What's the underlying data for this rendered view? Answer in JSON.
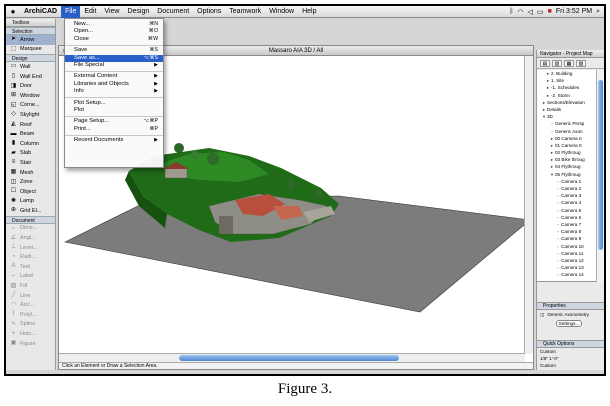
{
  "menubar": {
    "app": "ArchiCAD",
    "menus": [
      "File",
      "Edit",
      "View",
      "Design",
      "Document",
      "Options",
      "Teamwork",
      "Window",
      "Help"
    ],
    "clock": "Fri 3:52 PM",
    "flag": "■"
  },
  "toolbox": {
    "title": "Toolbox",
    "selection_label": "Selection",
    "arrow_label": "Arrow",
    "marquee_label": "Marquee",
    "design_section": "Design",
    "design_tools": [
      {
        "label": "Wall",
        "icon": "▭"
      },
      {
        "label": "Wall End",
        "icon": "▯"
      },
      {
        "label": "Door",
        "icon": "◨"
      },
      {
        "label": "Window",
        "icon": "⊞"
      },
      {
        "label": "Corne...",
        "icon": "◱"
      },
      {
        "label": "Skylight",
        "icon": "◇"
      },
      {
        "label": "Roof",
        "icon": "◭"
      },
      {
        "label": "Beam",
        "icon": "▬"
      },
      {
        "label": "Column",
        "icon": "▮"
      },
      {
        "label": "Slab",
        "icon": "▰"
      },
      {
        "label": "Stair",
        "icon": "≡"
      },
      {
        "label": "Mesh",
        "icon": "▦"
      },
      {
        "label": "Zone",
        "icon": "◫"
      },
      {
        "label": "Object",
        "icon": "☐"
      },
      {
        "label": "Lamp",
        "icon": "✺"
      },
      {
        "label": "Grid El...",
        "icon": "⊕"
      }
    ],
    "document_section": "Document",
    "document_tools": [
      {
        "label": "Dime...",
        "icon": "↔"
      },
      {
        "label": "Angl...",
        "icon": "∠"
      },
      {
        "label": "Level...",
        "icon": "⊥"
      },
      {
        "label": "Radi...",
        "icon": "◔"
      },
      {
        "label": "Text",
        "icon": "A"
      },
      {
        "label": "Label",
        "icon": "⌐"
      },
      {
        "label": "Fill",
        "icon": "▧"
      },
      {
        "label": "Line",
        "icon": "╱"
      },
      {
        "label": "Arc/...",
        "icon": "◠"
      },
      {
        "label": "Polyl...",
        "icon": "⌇"
      },
      {
        "label": "Spline",
        "icon": "∿"
      },
      {
        "label": "Hots...",
        "icon": "+"
      },
      {
        "label": "Figure",
        "icon": "▣"
      }
    ]
  },
  "file_menu": {
    "items": [
      {
        "type": "item",
        "label": "New...",
        "shortcut": "⌘N"
      },
      {
        "type": "item",
        "label": "Open...",
        "shortcut": "⌘O"
      },
      {
        "type": "item",
        "label": "Close",
        "shortcut": "⌘W"
      },
      {
        "type": "sep"
      },
      {
        "type": "item",
        "label": "Save",
        "shortcut": "⌘S"
      },
      {
        "type": "item",
        "label": "Save as...",
        "shortcut": "⌥⌘S",
        "highlight": true
      },
      {
        "type": "sub",
        "label": "File Special"
      },
      {
        "type": "sep"
      },
      {
        "type": "sub",
        "label": "External Content"
      },
      {
        "type": "sub",
        "label": "Libraries and Objects"
      },
      {
        "type": "sub",
        "label": "Info"
      },
      {
        "type": "sep"
      },
      {
        "type": "item",
        "label": "Plot Setup...",
        "shortcut": ""
      },
      {
        "type": "item",
        "label": "Plot",
        "shortcut": ""
      },
      {
        "type": "sep"
      },
      {
        "type": "item",
        "label": "Page Setup...",
        "shortcut": "⌥⌘P"
      },
      {
        "type": "item",
        "label": "Print...",
        "shortcut": "⌘P"
      },
      {
        "type": "sep"
      },
      {
        "type": "sub",
        "label": "Recent Documents"
      }
    ]
  },
  "window3d": {
    "title": "Massaro AIA 3D / All",
    "status": "Click an Element or Draw a Selection Area."
  },
  "navigator": {
    "title": "Navigator - Project Map",
    "tree": [
      {
        "label": "2. Building",
        "icon": "▸"
      },
      {
        "label": "1. Site",
        "icon": "▸"
      },
      {
        "label": "-1. Schedules",
        "icon": "▸"
      },
      {
        "label": "-2. Storm",
        "icon": "▸"
      },
      {
        "label": "Sections/Elevation",
        "icon": "▸"
      },
      {
        "label": "Details",
        "icon": "▸"
      },
      {
        "label": "3D",
        "icon": "▾"
      },
      {
        "label": "Generic Persp",
        "icon": "◦"
      },
      {
        "label": "Generic Axon",
        "icon": "◦"
      },
      {
        "label": "00 Camera 0",
        "icon": "▸"
      },
      {
        "label": "01 Camera 0",
        "icon": "▸"
      },
      {
        "label": "02 Flythroug",
        "icon": "▸"
      },
      {
        "label": "03 Bike throug",
        "icon": "▸"
      },
      {
        "label": "04 Flythroug",
        "icon": "▸"
      },
      {
        "label": "05 Flythroug",
        "icon": "▾"
      },
      {
        "label": "Camera 1",
        "icon": "◦"
      },
      {
        "label": "Camera 2",
        "icon": "◦"
      },
      {
        "label": "Camera 3",
        "icon": "◦"
      },
      {
        "label": "Camera 4",
        "icon": "◦"
      },
      {
        "label": "Camera 5",
        "icon": "◦"
      },
      {
        "label": "Camera 6",
        "icon": "◦"
      },
      {
        "label": "Camera 7",
        "icon": "◦"
      },
      {
        "label": "Camera 8",
        "icon": "◦"
      },
      {
        "label": "Camera 9",
        "icon": "◦"
      },
      {
        "label": "Camera 10",
        "icon": "◦"
      },
      {
        "label": "Camera 11",
        "icon": "◦"
      },
      {
        "label": "Camera 12",
        "icon": "◦"
      },
      {
        "label": "Camera 13",
        "icon": "◦"
      },
      {
        "label": "Camera 14",
        "icon": "◦"
      }
    ],
    "properties_title": "Properties",
    "properties_value": "Generic Axonometry",
    "settings_label": "Settings...",
    "quick_title": "Quick Options",
    "quick_rows": [
      "Custom",
      "1/8\"   1'-0\"",
      "Custom"
    ]
  },
  "caption": "Figure 3.",
  "colors": {
    "menu_highlight": "#2a5fc9",
    "terrain_green": "#1f6b17",
    "plane_gray": "#7c7c7c"
  }
}
